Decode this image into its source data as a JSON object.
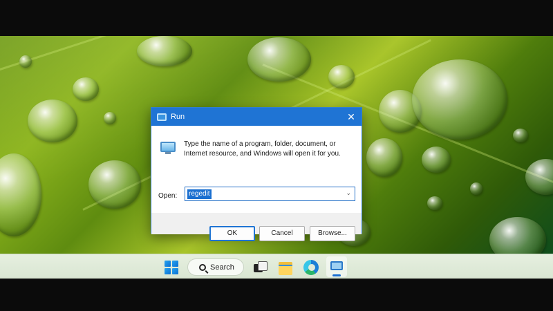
{
  "dialog": {
    "title": "Run",
    "icon": "run-icon",
    "description": "Type the name of a program, folder, document, or Internet resource, and Windows will open it for you.",
    "open_label": "Open:",
    "open_value": "regedit",
    "buttons": {
      "ok": "OK",
      "cancel": "Cancel",
      "browse": "Browse..."
    },
    "close_glyph": "✕"
  },
  "taskbar": {
    "search_label": "Search",
    "icons": [
      "windows-start-icon",
      "search-icon",
      "task-view-icon",
      "file-explorer-icon",
      "edge-icon",
      "run-app-icon"
    ]
  },
  "colors": {
    "titlebar": "#1f74d4",
    "accent": "#1a6fd0",
    "dialog_bg": "#f0f0f0",
    "taskbar_bg": "#dfe9d8"
  }
}
